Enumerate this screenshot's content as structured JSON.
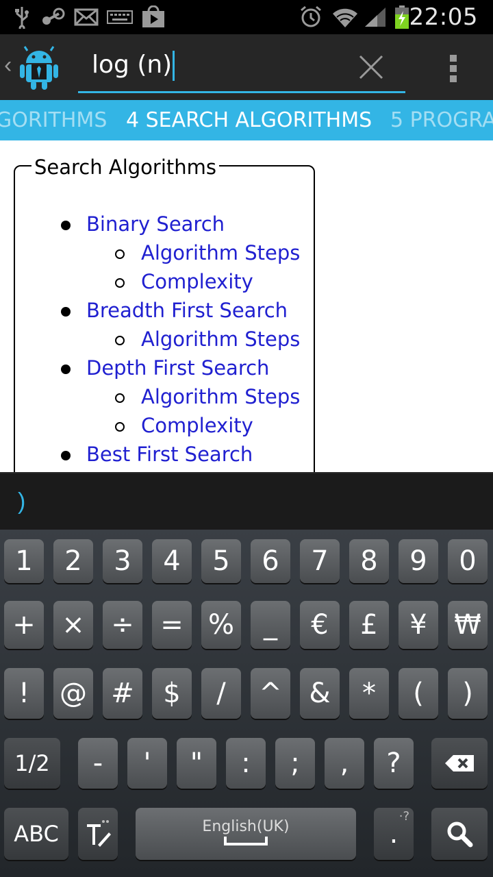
{
  "status_bar": {
    "time": "22:05",
    "icons": [
      "usb-icon",
      "steam-icon",
      "mail-icon",
      "keyboard-icon",
      "play-store-icon",
      "alarm-icon",
      "wifi-icon",
      "signal-icon",
      "battery-charging-icon"
    ]
  },
  "action_bar": {
    "search_value": "log (n)",
    "clear_icon": "close-icon",
    "overflow_icon": "overflow-menu-icon"
  },
  "tabs": [
    {
      "label": "GORITHMS",
      "state": "previous"
    },
    {
      "label": "4 SEARCH ALGORITHMS",
      "state": "active"
    },
    {
      "label": "5 PROGRA",
      "state": "next"
    }
  ],
  "content": {
    "fieldset_title": "Search Algorithms",
    "items": [
      {
        "label": "Binary Search",
        "level": 1
      },
      {
        "label": "Algorithm Steps",
        "level": 2
      },
      {
        "label": "Complexity",
        "level": 2
      },
      {
        "label": "Breadth First Search",
        "level": 1
      },
      {
        "label": "Algorithm Steps",
        "level": 2
      },
      {
        "label": "Depth First Search",
        "level": 1
      },
      {
        "label": "Algorithm Steps",
        "level": 2
      },
      {
        "label": "Complexity",
        "level": 2
      },
      {
        "label": "Best First Search",
        "level": 1
      }
    ]
  },
  "candidate_bar": {
    "text": ")"
  },
  "keyboard": {
    "row1": [
      "1",
      "2",
      "3",
      "4",
      "5",
      "6",
      "7",
      "8",
      "9",
      "0"
    ],
    "row2": [
      "+",
      "×",
      "÷",
      "=",
      "%",
      "_",
      "€",
      "£",
      "¥",
      "₩"
    ],
    "row3": [
      "!",
      "@",
      "#",
      "$",
      "/",
      "^",
      "&",
      "*",
      "(",
      ")"
    ],
    "row4": {
      "shift": "1/2",
      "keys": [
        "-",
        "'",
        "\"",
        ":",
        ";",
        ","
      ],
      "question": "?",
      "backspace_icon": "backspace-icon"
    },
    "row5": {
      "abc": "ABC",
      "text_tools_icon": "text-edit-icon",
      "space_label": "English(UK)",
      "period": ".",
      "period_alt": "·?",
      "search_icon": "search-icon"
    }
  },
  "colors": {
    "accent": "#33b5e5",
    "link": "#2020d0"
  }
}
